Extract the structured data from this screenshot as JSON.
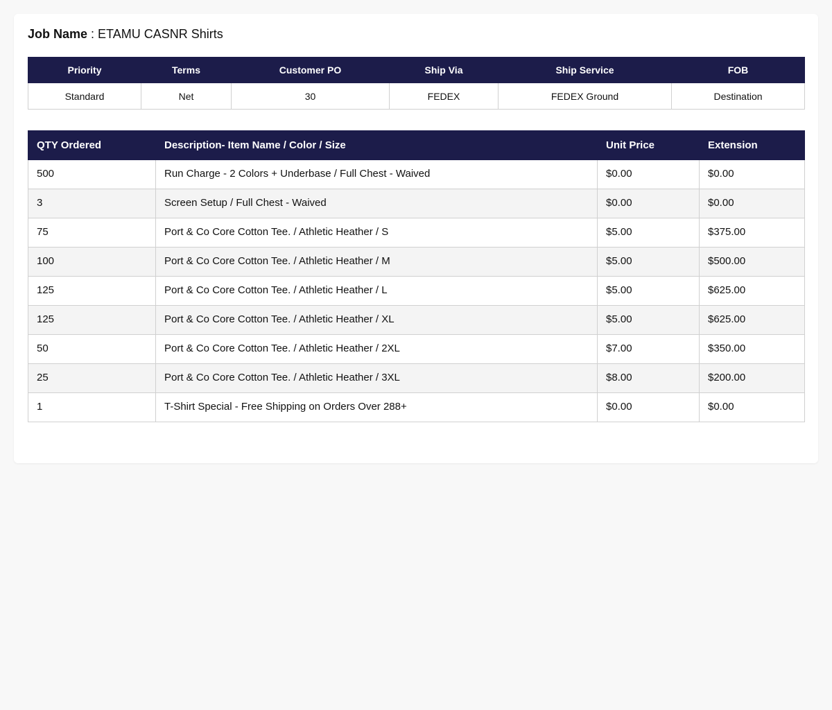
{
  "job": {
    "label": "Job Name",
    "separator": " : ",
    "value": "ETAMU CASNR Shirts"
  },
  "info": {
    "headers": [
      "Priority",
      "Terms",
      "Customer PO",
      "Ship Via",
      "Ship Service",
      "FOB"
    ],
    "values": [
      "Standard",
      "Net",
      "30",
      "FEDEX",
      "FEDEX Ground",
      "Destination"
    ]
  },
  "items": {
    "headers": [
      "QTY Ordered",
      "Description- Item Name / Color / Size",
      "Unit Price",
      "Extension"
    ],
    "rows": [
      {
        "qty": "500",
        "desc": "Run Charge - 2 Colors + Underbase / Full Chest - Waived",
        "price": "$0.00",
        "ext": "$0.00"
      },
      {
        "qty": "3",
        "desc": "Screen Setup / Full Chest - Waived",
        "price": "$0.00",
        "ext": "$0.00"
      },
      {
        "qty": "75",
        "desc": "Port & Co Core Cotton Tee. / Athletic Heather / S",
        "price": "$5.00",
        "ext": "$375.00"
      },
      {
        "qty": "100",
        "desc": "Port & Co Core Cotton Tee. / Athletic Heather / M",
        "price": "$5.00",
        "ext": "$500.00"
      },
      {
        "qty": "125",
        "desc": "Port & Co Core Cotton Tee. / Athletic Heather / L",
        "price": "$5.00",
        "ext": "$625.00"
      },
      {
        "qty": "125",
        "desc": "Port & Co Core Cotton Tee. / Athletic Heather / XL",
        "price": "$5.00",
        "ext": "$625.00"
      },
      {
        "qty": "50",
        "desc": "Port & Co Core Cotton Tee. / Athletic Heather / 2XL",
        "price": "$7.00",
        "ext": "$350.00"
      },
      {
        "qty": "25",
        "desc": "Port & Co Core Cotton Tee. / Athletic Heather / 3XL",
        "price": "$8.00",
        "ext": "$200.00"
      },
      {
        "qty": "1",
        "desc": "T-Shirt Special - Free Shipping on Orders Over 288+",
        "price": "$0.00",
        "ext": "$0.00"
      }
    ]
  },
  "colors": {
    "header_bg": "#1c1c4a",
    "page_bg": "#f8f8f8",
    "alt_row_bg": "#f4f4f4"
  }
}
